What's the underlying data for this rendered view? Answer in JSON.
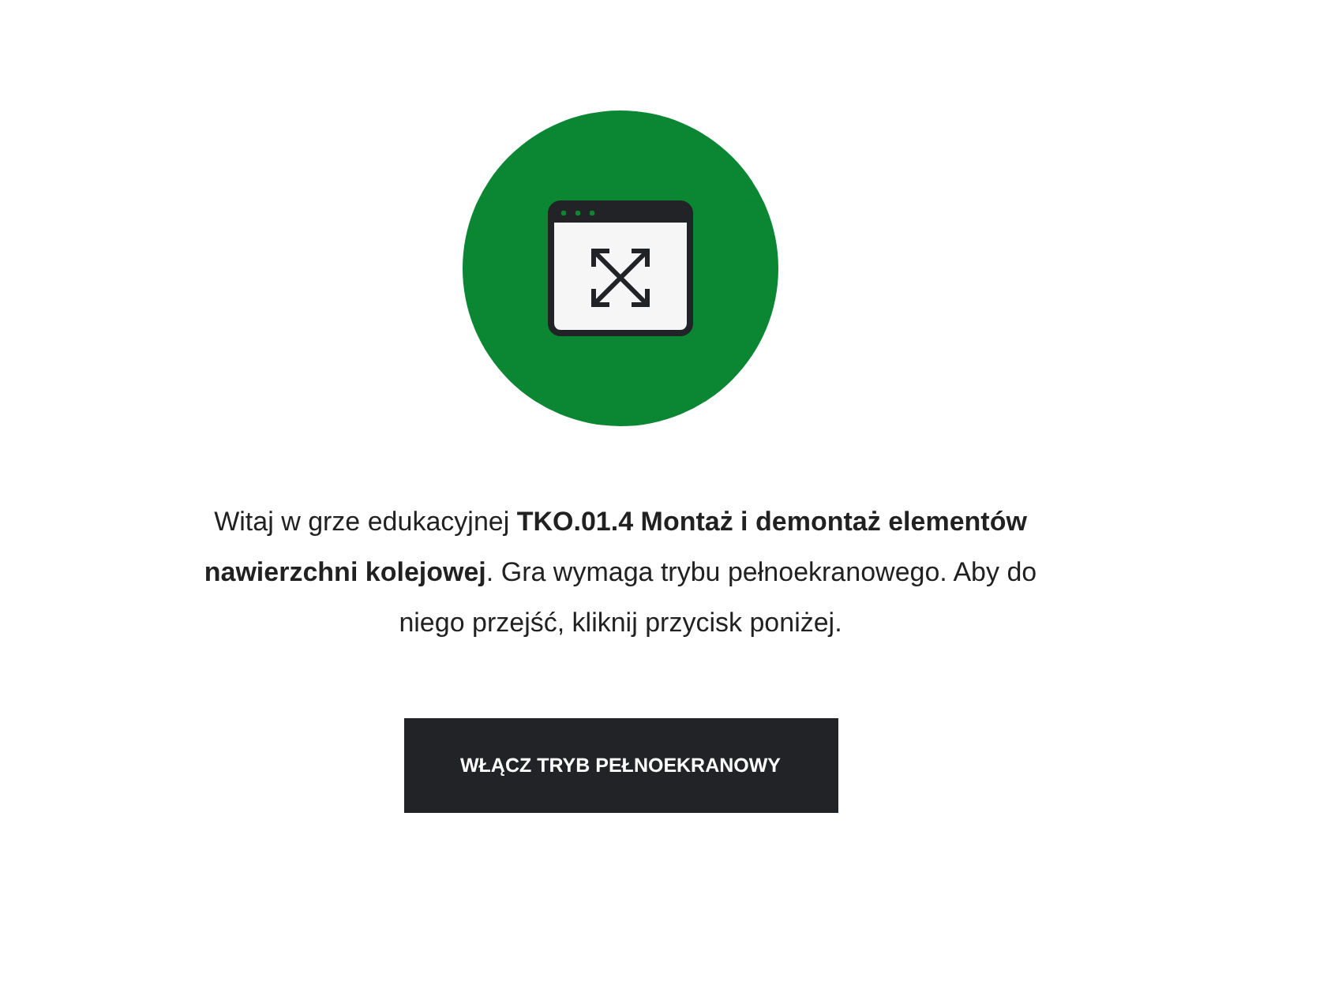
{
  "intro": {
    "text": "Witaj w grze edukacyjnej **TKO.01.4 Montaż i demontaż elementów nawierzchni kolejowej**. Gra wymaga trybu pełnoekranowego. Aby do niego przejść, kliknij przycisk poniżej."
  },
  "button": {
    "label": "WŁĄCZ TRYB PEŁNOEKRANOWY"
  }
}
